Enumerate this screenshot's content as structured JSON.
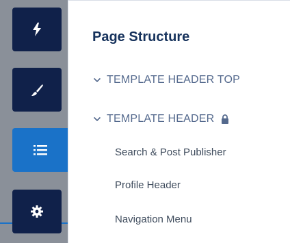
{
  "rail": {
    "buttons": [
      {
        "id": "lightning",
        "icon": "lightning-icon",
        "active": false
      },
      {
        "id": "brush",
        "icon": "brush-icon",
        "active": false
      },
      {
        "id": "page-structure",
        "icon": "list-icon",
        "active": true
      },
      {
        "id": "settings",
        "icon": "gear-icon",
        "active": false
      }
    ],
    "colors": {
      "dark": "#10214a",
      "active": "#1a72c8",
      "rail_bg": "#8a9099"
    }
  },
  "panel": {
    "title": "Page Structure",
    "sections": [
      {
        "label": "TEMPLATE HEADER TOP",
        "expanded": true,
        "locked": false
      },
      {
        "label": "TEMPLATE HEADER",
        "expanded": true,
        "locked": true
      }
    ],
    "components": [
      {
        "label": "Search & Post Publisher"
      },
      {
        "label": "Profile Header"
      },
      {
        "label": "Navigation Menu"
      }
    ]
  }
}
